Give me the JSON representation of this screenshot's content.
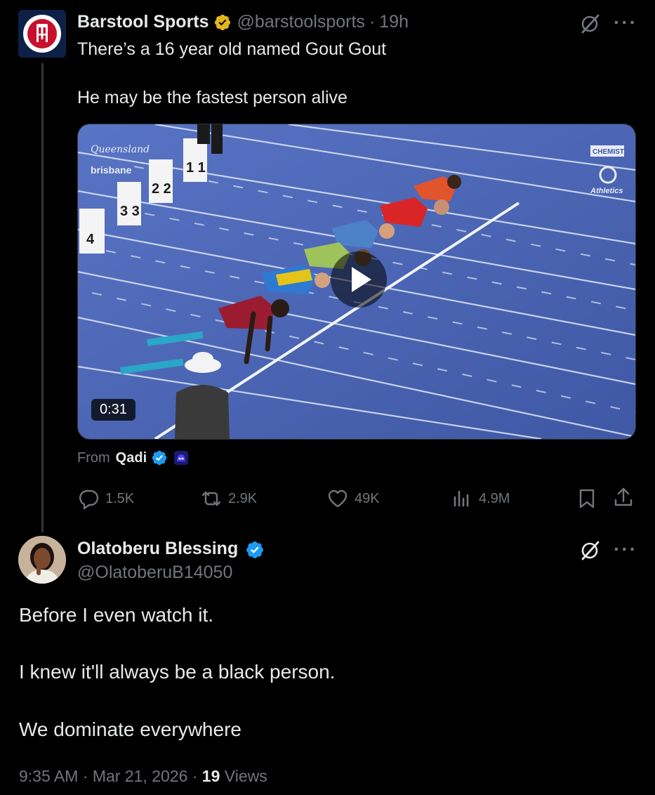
{
  "original_tweet": {
    "author_name": "Barstool Sports",
    "handle": "@barstoolsports",
    "separator": "·",
    "time": "19h",
    "text_line1": "There’s a 16 year old named Gout Gout",
    "text_line2": "He may be the fastest person alive",
    "video_duration": "0:31",
    "from_label": "From",
    "from_name": "Qadi",
    "stats": {
      "replies": "1.5K",
      "reposts": "2.9K",
      "likes": "49K",
      "views": "4.9M"
    },
    "more_label": "···"
  },
  "reply_tweet": {
    "author_name": "Olatoberu Blessing",
    "handle": "@OlatoberuB14050",
    "more_label": "···",
    "text_line1": "Before I even watch it.",
    "text_line2": "I knew it'll always be a black person.",
    "text_line3": "We dominate everywhere",
    "timestamp": "9:35 AM · Mar 21, 2026 · ",
    "views_count": "19",
    "views_label": " Views"
  },
  "colors": {
    "background": "#000000",
    "text": "#e7e9ea",
    "muted": "#71767b",
    "verified_blue": "#1d9bf0",
    "verified_gold": "#e2b719",
    "track_blue": "#4e69b8"
  },
  "icons": [
    "grok-icon",
    "more-icon",
    "reply-icon",
    "repost-icon",
    "like-icon",
    "views-icon",
    "bookmark-icon",
    "share-icon",
    "play-icon",
    "verified-badge-icon"
  ]
}
